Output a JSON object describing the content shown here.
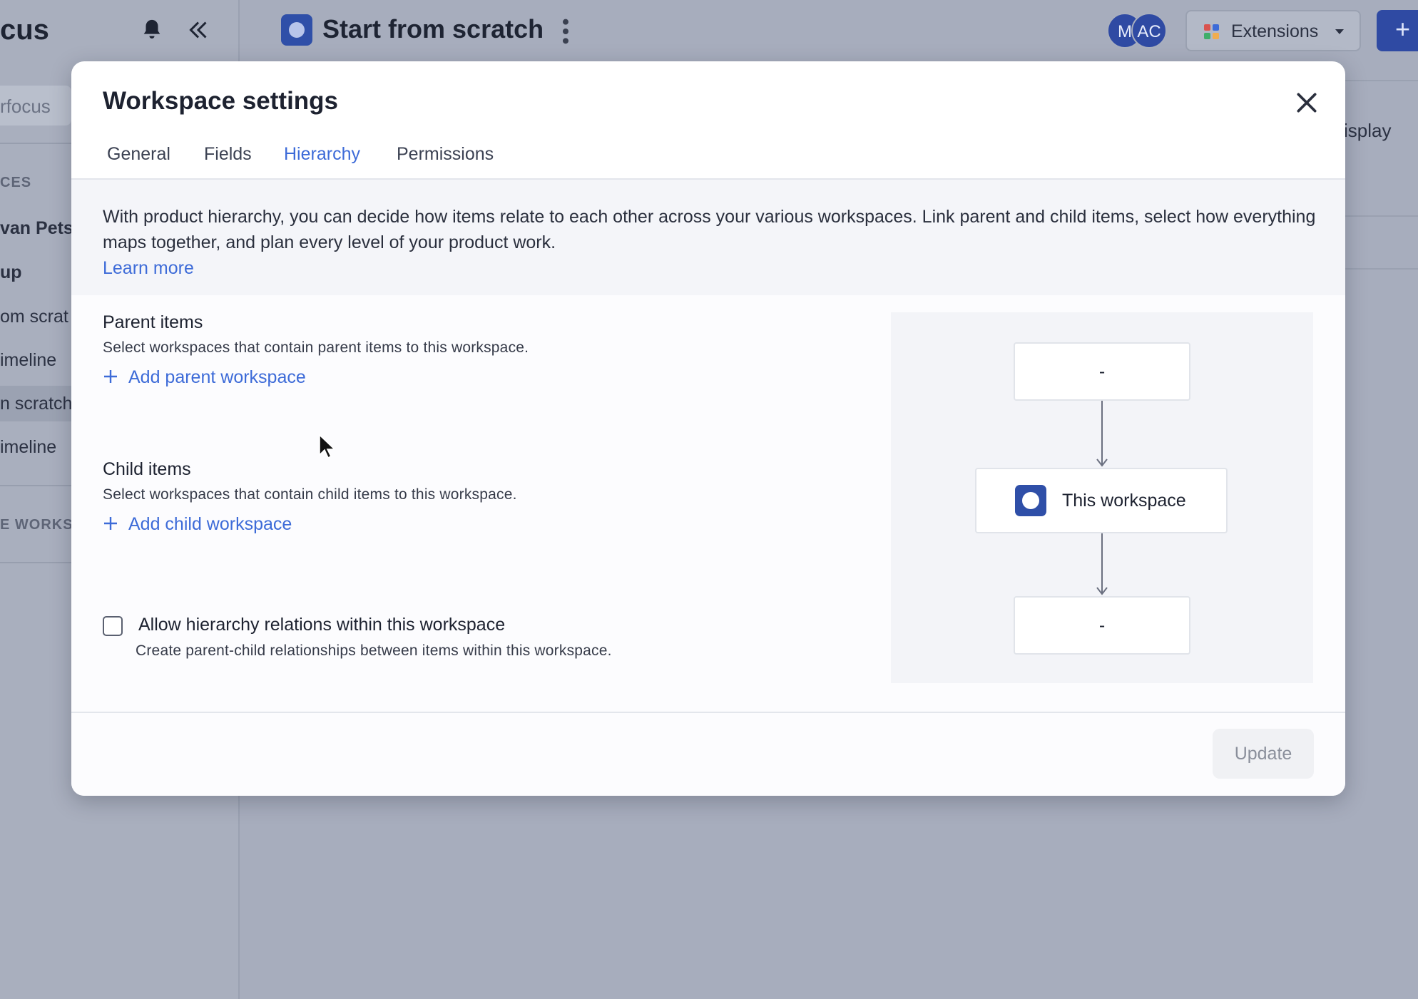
{
  "sidebar": {
    "brand": "cus",
    "search_placeholder": "rfocus",
    "section_heading": "CES",
    "items": [
      "van Pets",
      "up",
      "om scrat",
      "imeline",
      "n scratch",
      "imeline"
    ],
    "section_heading_2": "E WORKS"
  },
  "topbar": {
    "title": "Start from scratch",
    "avatars": [
      "M",
      "AC"
    ],
    "extensions_label": "Extensions",
    "add_label": "+"
  },
  "background": {
    "display_label": "isplay"
  },
  "modal": {
    "title": "Workspace settings",
    "tabs": [
      {
        "label": "General"
      },
      {
        "label": "Fields"
      },
      {
        "label": "Hierarchy"
      },
      {
        "label": "Permissions"
      }
    ],
    "active_tab": "Hierarchy",
    "intro": {
      "text": "With product hierarchy, you can decide how items relate to each other across your various workspaces. Link parent and child items, select how everything maps together, and plan every level of your product work.",
      "link": "Learn more"
    },
    "parent": {
      "title": "Parent items",
      "description": "Select workspaces that contain parent items to this workspace.",
      "add_label": "Add parent workspace"
    },
    "child": {
      "title": "Child items",
      "description": "Select workspaces that contain child items to this workspace.",
      "add_label": "Add child workspace"
    },
    "allow_relations": {
      "label": "Allow hierarchy relations within this workspace",
      "description": "Create parent-child relationships between items within this workspace.",
      "checked": false
    },
    "diagram": {
      "parent_node": "-",
      "current_node": "This workspace",
      "child_node": "-"
    },
    "update_label": "Update"
  },
  "colors": {
    "accent": "#3d6bd8",
    "brand_blue": "#2f4fa8",
    "overlay": "#a7adbd"
  }
}
